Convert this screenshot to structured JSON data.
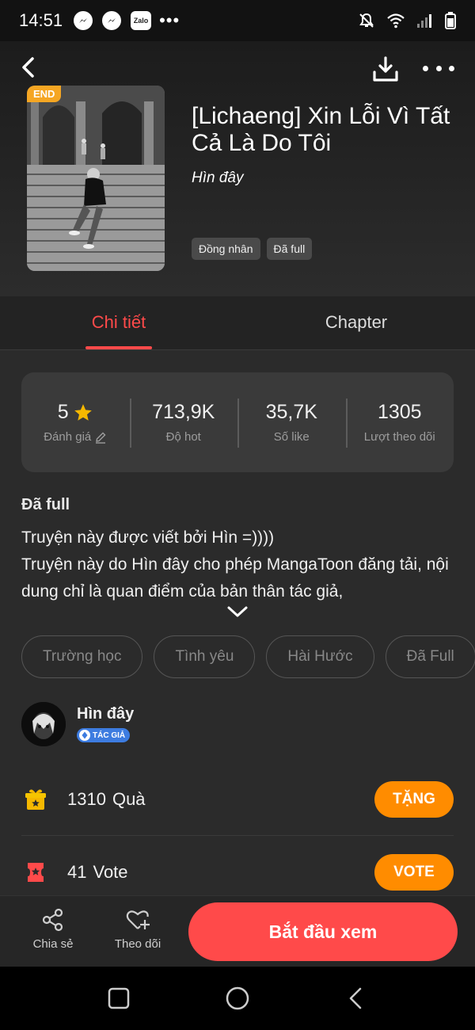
{
  "status_bar": {
    "time": "14:51",
    "app_icons": [
      "messenger-icon",
      "messenger-icon",
      "zalo-icon"
    ],
    "zalo_label": "Zalo",
    "more": "•••"
  },
  "header": {
    "back_icon": "chevron-left-icon",
    "download_icon": "download-icon",
    "more_icon": "more-horizontal-icon"
  },
  "book": {
    "badge": "END",
    "title": "[Lichaeng] Xin Lỗi Vì Tất Cả Là Do Tôi",
    "author": "Hìn đây",
    "genres": [
      "Đồng nhân",
      "Đã full"
    ]
  },
  "tabs": [
    {
      "label": "Chi tiết",
      "active": true
    },
    {
      "label": "Chapter",
      "active": false
    }
  ],
  "stats": [
    {
      "value": "5",
      "label": "Đánh giá"
    },
    {
      "value": "713,9K",
      "label": "Độ hot"
    },
    {
      "value": "35,7K",
      "label": "Số like"
    },
    {
      "value": "1305",
      "label": "Lượt theo dõi"
    }
  ],
  "description": {
    "status": "Đã full",
    "line1": "Truyện này được viết bởi Hìn =))))",
    "line2": "Truyện này do Hìn đây cho phép MangaToon đăng tải, nội dung chỉ là quan điểm của bản thân tác giả,"
  },
  "tags": [
    "Trường học",
    "Tình yêu",
    "Hài Hước",
    "Đã Full"
  ],
  "author_section": {
    "name": "Hìn đây",
    "badge": "TÁC GIẢ"
  },
  "gift": {
    "count": "1310",
    "label": "Quà",
    "button": "TẶNG"
  },
  "vote": {
    "count": "41",
    "label": "Vote",
    "button": "VOTE"
  },
  "bottom_bar": {
    "share": "Chia sẻ",
    "follow": "Theo dõi",
    "start": "Bắt đầu xem"
  },
  "colors": {
    "accent": "#ff4a4a",
    "button_orange": "#ff8c00",
    "badge_yellow": "#f5a623"
  }
}
